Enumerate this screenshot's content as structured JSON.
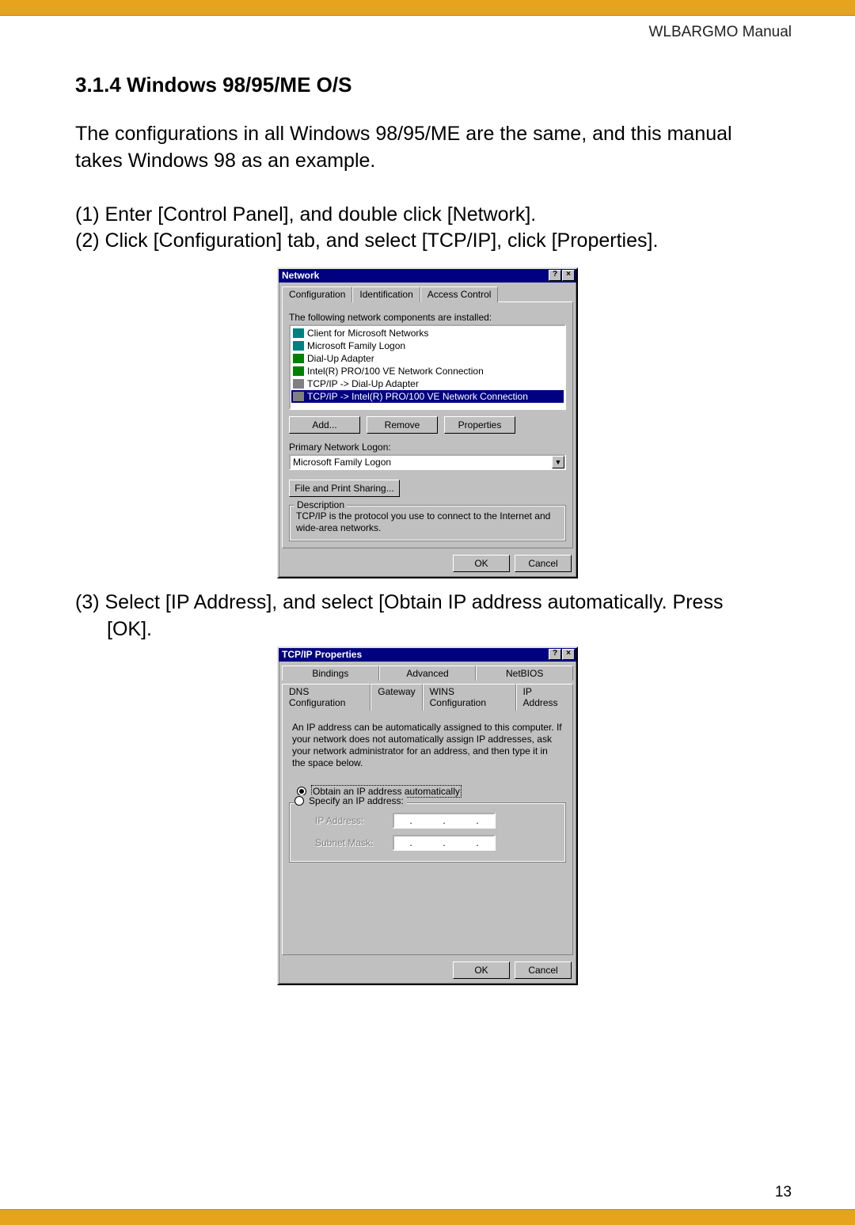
{
  "header": {
    "manual_title": "WLBARGMO Manual"
  },
  "section": {
    "heading": "3.1.4 Windows 98/95/ME O/S"
  },
  "intro": "The configurations in all Windows 98/95/ME are the same, and this manual takes Windows 98 as an example.",
  "steps": {
    "s1": "(1) Enter [Control Panel], and double click [Network].",
    "s2": "(2) Click [Configuration] tab, and select [TCP/IP], click [Properties].",
    "s3": "(3) Select [IP Address], and select [Obtain IP address automatically. Press",
    "s3b": "[OK]."
  },
  "dlg1": {
    "title": "Network",
    "help_btn": "?",
    "close_btn": "×",
    "tabs": {
      "t1": "Configuration",
      "t2": "Identification",
      "t3": "Access Control"
    },
    "installed_label": "The following network components are installed:",
    "components": {
      "c1": "Client for Microsoft Networks",
      "c2": "Microsoft Family Logon",
      "c3": "Dial-Up Adapter",
      "c4": "Intel(R) PRO/100 VE Network Connection",
      "c5": "TCP/IP -> Dial-Up Adapter",
      "c6": "TCP/IP -> Intel(R) PRO/100 VE Network Connection"
    },
    "buttons": {
      "add": "Add...",
      "remove": "Remove",
      "properties": "Properties"
    },
    "primary_label": "Primary Network Logon:",
    "primary_value": "Microsoft Family Logon",
    "file_share_btn": "File and Print Sharing...",
    "desc_legend": "Description",
    "desc_text": "TCP/IP is the protocol you use to connect to the Internet and wide-area networks.",
    "ok": "OK",
    "cancel": "Cancel"
  },
  "dlg2": {
    "title": "TCP/IP Properties",
    "help_btn": "?",
    "close_btn": "×",
    "tabs_row1": {
      "t1": "Bindings",
      "t2": "Advanced",
      "t3": "NetBIOS"
    },
    "tabs_row2": {
      "t4": "DNS Configuration",
      "t5": "Gateway",
      "t6": "WINS Configuration",
      "t7": "IP Address"
    },
    "explain": "An IP address can be automatically assigned to this computer. If your network does not automatically assign IP addresses, ask your network administrator for an address, and then type it in the space below.",
    "radio_auto": "Obtain an IP address automatically",
    "radio_specify": "Specify an IP address:",
    "ip_label": "IP Address:",
    "mask_label": "Subnet Mask:",
    "ok": "OK",
    "cancel": "Cancel"
  },
  "page_number": "13"
}
